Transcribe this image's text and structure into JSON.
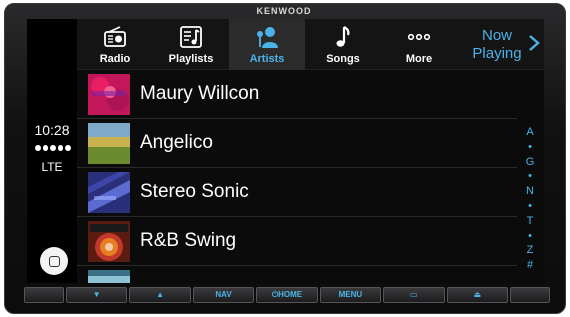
{
  "device": {
    "brand": "KENWOOD"
  },
  "status": {
    "time": "10:28",
    "network": "LTE",
    "signal_bars": 5
  },
  "tabs": [
    {
      "label": "Radio",
      "icon": "radio-icon",
      "active": false
    },
    {
      "label": "Playlists",
      "icon": "playlist-icon",
      "active": false
    },
    {
      "label": "Artists",
      "icon": "artist-icon",
      "active": true
    },
    {
      "label": "Songs",
      "icon": "music-note-icon",
      "active": false
    },
    {
      "label": "More",
      "icon": "more-dots-icon",
      "active": false
    }
  ],
  "now_playing": {
    "label_line1": "Now",
    "label_line2": "Playing"
  },
  "artists": [
    {
      "name": "Maury Willcon"
    },
    {
      "name": "Angelico"
    },
    {
      "name": "Stereo Sonic"
    },
    {
      "name": "R&B Swing"
    }
  ],
  "index_letters": [
    "A",
    "•",
    "G",
    "•",
    "N",
    "•",
    "T",
    "•",
    "Z",
    "#"
  ],
  "hardware_buttons": [
    {
      "label": ""
    },
    {
      "label": "▼"
    },
    {
      "label": "▲"
    },
    {
      "label": "NAV"
    },
    {
      "label": "⏻HOME"
    },
    {
      "label": "MENU"
    },
    {
      "label": "▭"
    },
    {
      "label": "⏏"
    },
    {
      "label": ""
    }
  ],
  "colors": {
    "accent": "#4bb3e8",
    "background": "#0b0b0b"
  }
}
